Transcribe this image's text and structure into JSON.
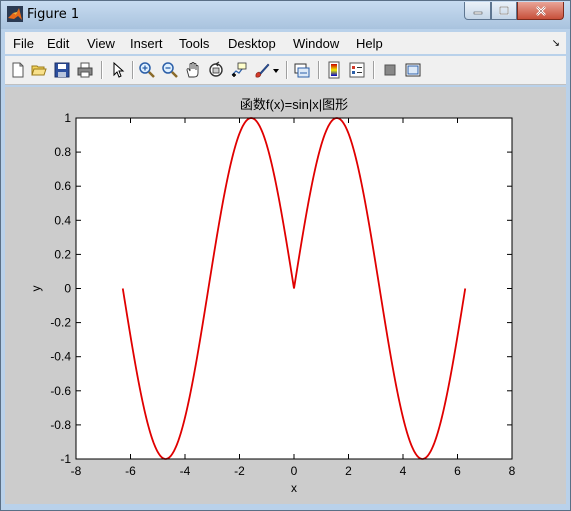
{
  "window": {
    "title": "Figure 1",
    "app_icon": "matlab-logo-icon",
    "controls": [
      "minimize-icon",
      "maximize-icon",
      "close-icon"
    ]
  },
  "menubar": {
    "items": [
      "File",
      "Edit",
      "View",
      "Insert",
      "Tools",
      "Desktop",
      "Window",
      "Help"
    ],
    "overflow_icon": "chevron-icon"
  },
  "toolbar": {
    "tools": [
      "new-figure-icon",
      "open-file-icon",
      "save-icon",
      "print-icon",
      "edit-plot-arrow-icon",
      "zoom-in-icon",
      "zoom-out-icon",
      "pan-hand-icon",
      "rotate-3d-icon",
      "data-cursor-icon",
      "brush-icon",
      "brush-dropdown-icon",
      "link-plot-icon",
      "insert-colorbar-icon",
      "insert-legend-icon",
      "hide-plot-tools-icon",
      "show-plot-tools-icon"
    ]
  },
  "colors": {
    "line": "#e00000",
    "figure_bg": "#cccccc",
    "axes_bg": "#ffffff"
  },
  "chart_data": {
    "type": "line",
    "title": "函数f(x)=sin|x|图形",
    "xlabel": "x",
    "ylabel": "y",
    "xlim": [
      -8,
      8
    ],
    "ylim": [
      -1,
      1
    ],
    "xticks": [
      -8,
      -6,
      -4,
      -2,
      0,
      2,
      4,
      6,
      8
    ],
    "yticks": [
      -1,
      -0.8,
      -0.6,
      -0.4,
      -0.2,
      0,
      0.2,
      0.4,
      0.6,
      0.8,
      1
    ],
    "xtick_labels": [
      "-8",
      "-6",
      "-4",
      "-2",
      "0",
      "2",
      "4",
      "6",
      "8"
    ],
    "ytick_labels": [
      "-1",
      "-0.8",
      "-0.6",
      "-0.4",
      "-0.2",
      "0",
      "0.2",
      "0.4",
      "0.6",
      "0.8",
      "1"
    ],
    "grid": false,
    "series": [
      {
        "function": "sin(abs(x))",
        "x_range": [
          -6.2832,
          6.2832
        ],
        "color": "#e00000"
      }
    ]
  }
}
